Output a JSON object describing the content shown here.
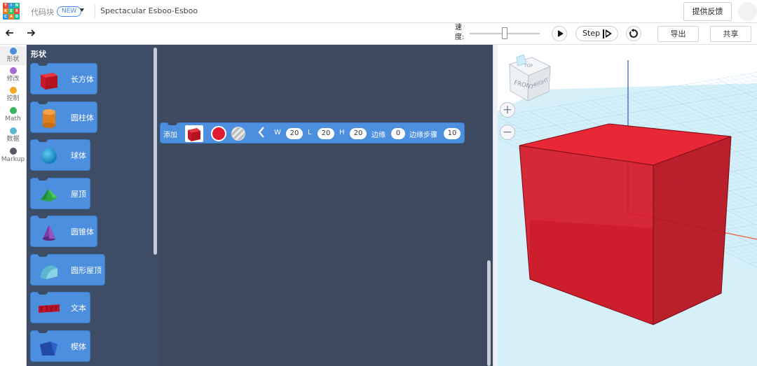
{
  "header": {
    "logo_letters": [
      "T",
      "I",
      "N",
      "K",
      "E",
      "R",
      "C",
      "A",
      "D"
    ],
    "logo_colors": [
      "#e74c3c",
      "#3498db",
      "#1abc9c",
      "#e67e22",
      "#2ecc71",
      "#e74c3c",
      "#3498db",
      "#e67e22",
      "#1abc9c"
    ],
    "project_type": "代码块",
    "new_badge": "NEW",
    "design_name": "Spectacular Esboo-Esboo",
    "feedback_label": "提供反馈"
  },
  "toolbar": {
    "undo_icon": "undo-icon",
    "redo_icon": "redo-icon",
    "speed_label": "速度:",
    "speed_value": 0.5,
    "step_label": "Step",
    "export_label": "导出",
    "share_label": "共享"
  },
  "categories": [
    {
      "label": "形状",
      "color": "#4c8fde",
      "active": true
    },
    {
      "label": "修改",
      "color": "#a66bd3"
    },
    {
      "label": "控制",
      "color": "#f5a623"
    },
    {
      "label": "Math",
      "color": "#3db35d"
    },
    {
      "label": "数据",
      "color": "#5fb7d4"
    },
    {
      "label": "Markup",
      "color": "#555c66"
    }
  ],
  "flyout": {
    "title": "形状",
    "blocks": [
      {
        "label": "长方体",
        "icon": "box-icon"
      },
      {
        "label": "圆柱体",
        "icon": "cylinder-icon"
      },
      {
        "label": "球体",
        "icon": "sphere-icon"
      },
      {
        "label": "屋顶",
        "icon": "roof-icon"
      },
      {
        "label": "圆锥体",
        "icon": "cone-icon"
      },
      {
        "label": "圆形屋顶",
        "icon": "round-roof-icon"
      },
      {
        "label": "文本",
        "icon": "text-icon"
      },
      {
        "label": "楔体",
        "icon": "wedge-icon"
      }
    ]
  },
  "workspace_block": {
    "add_label": "添加",
    "shape": "box",
    "color": "#e01c30",
    "w_label": "W",
    "w_value": "20",
    "l_label": "L",
    "l_value": "20",
    "h_label": "H",
    "h_value": "20",
    "bevel_label": "边缘",
    "bevel_value": "0",
    "steps_label": "边缘步骤",
    "steps_value": "10"
  },
  "viewport": {
    "viewcube_front": "FRONT",
    "viewcube_right": "RIGHT",
    "viewcube_top": "TOP",
    "zoom_in": "+",
    "zoom_out": "−",
    "object_color": "#e0202e",
    "grid_color": "#8fd3ec"
  }
}
